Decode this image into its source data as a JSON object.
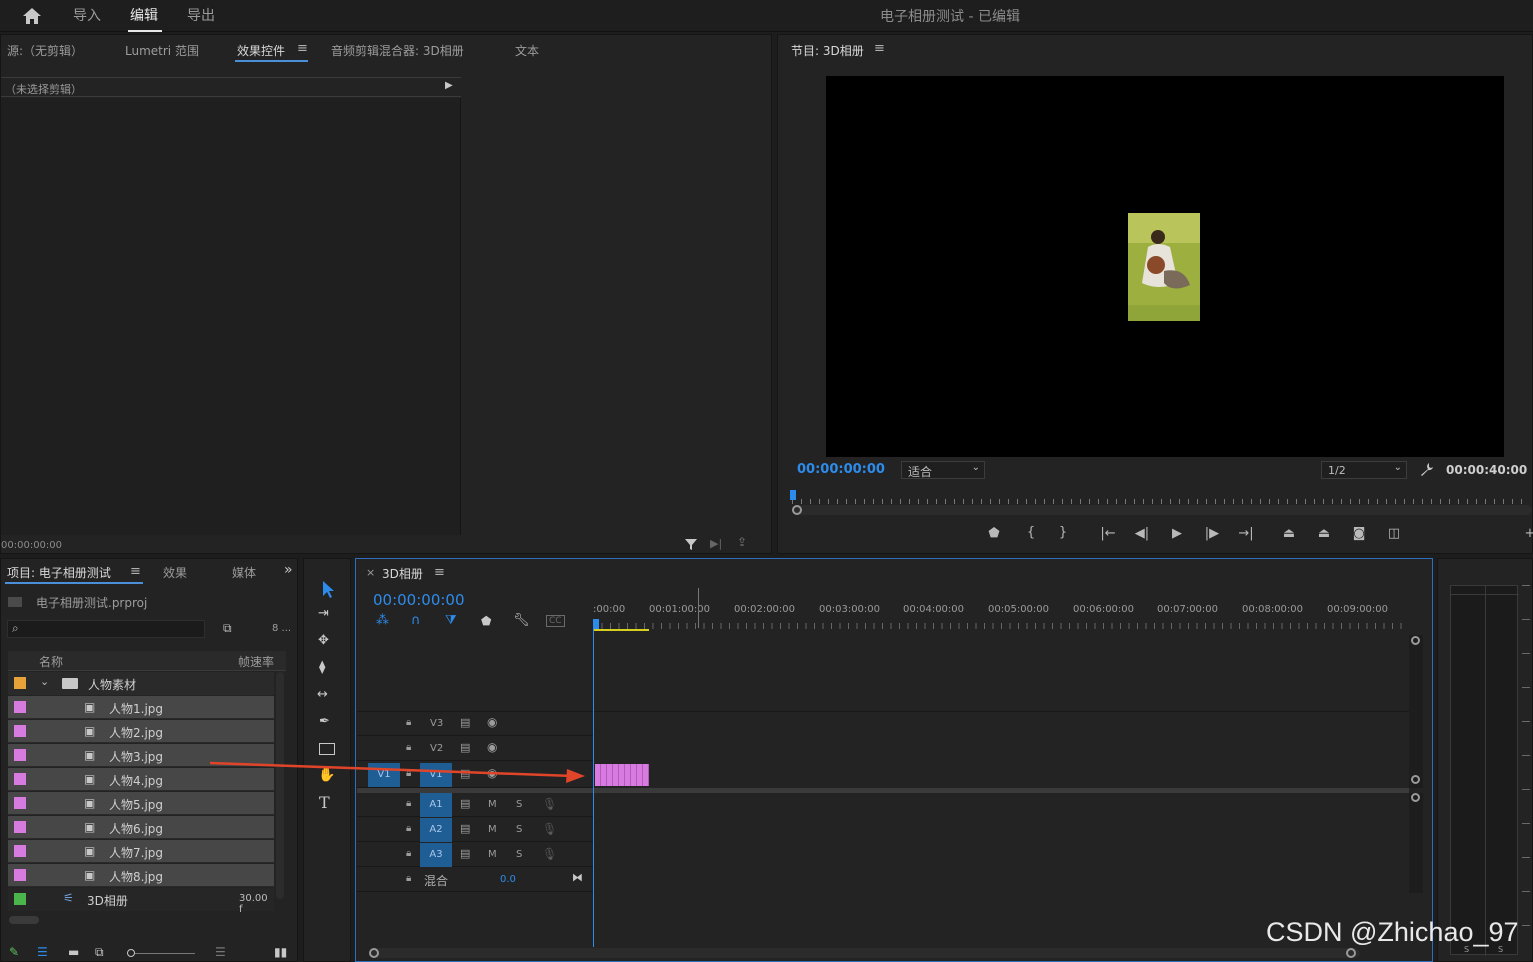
{
  "topbar": {
    "tabs": [
      "导入",
      "编辑",
      "导出"
    ],
    "title": "电子相册测试 - 已编辑"
  },
  "source_panel": {
    "tabs": [
      "源:（无剪辑）",
      "Lumetri 范围",
      "效果控件",
      "音频剪辑混合器: 3D相册",
      "文本"
    ],
    "menu_glyph": "≡",
    "subheader": "（未选择剪辑）",
    "timecode": "00:00:00:00"
  },
  "program_panel": {
    "title": "节目: 3D相册",
    "menu_glyph": "≡",
    "timecode_current": "00:00:00:00",
    "zoom_select": "适合",
    "resolution_select": "1/2",
    "timecode_duration": "00:00:40:00"
  },
  "project_panel": {
    "tabs": [
      "项目: 电子相册测试",
      "效果",
      "媒体"
    ],
    "menu_glyph": "≡",
    "overflow_glyph": "»",
    "project_file": "电子相册测试.prproj",
    "item_count": "8 ...",
    "columns": {
      "name": "名称",
      "framerate": "帧速率"
    },
    "folder": "人物素材",
    "files": [
      "人物1.jpg",
      "人物2.jpg",
      "人物3.jpg",
      "人物4.jpg",
      "人物5.jpg",
      "人物6.jpg",
      "人物7.jpg",
      "人物8.jpg"
    ],
    "sequence": {
      "name": "3D相册",
      "framerate": "30.00 f"
    }
  },
  "timeline": {
    "title": "3D相册",
    "close_glyph": "×",
    "menu_glyph": "≡",
    "timecode": "00:00:00:00",
    "ruler": [
      ":00:00",
      "00:01:00:00",
      "00:02:00:00",
      "00:03:00:00",
      "00:04:00:00",
      "00:05:00:00",
      "00:06:00:00",
      "00:07:00:00",
      "00:08:00:00",
      "00:09:00:00"
    ],
    "video_tracks": [
      "V3",
      "V2",
      "V1"
    ],
    "source_patch": "V1",
    "audio_tracks": [
      "A1",
      "A2",
      "A3"
    ],
    "mute_label": "M",
    "solo_label": "S",
    "mix_label": "混合",
    "mix_value": "0.0"
  },
  "watermark": "CSDN @Zhichao_97",
  "colors": {
    "accent_blue": "#2d8ceb",
    "clip_pink": "#d87be0",
    "track_patch": "#1f5e94",
    "arrow": "#e0452a"
  }
}
